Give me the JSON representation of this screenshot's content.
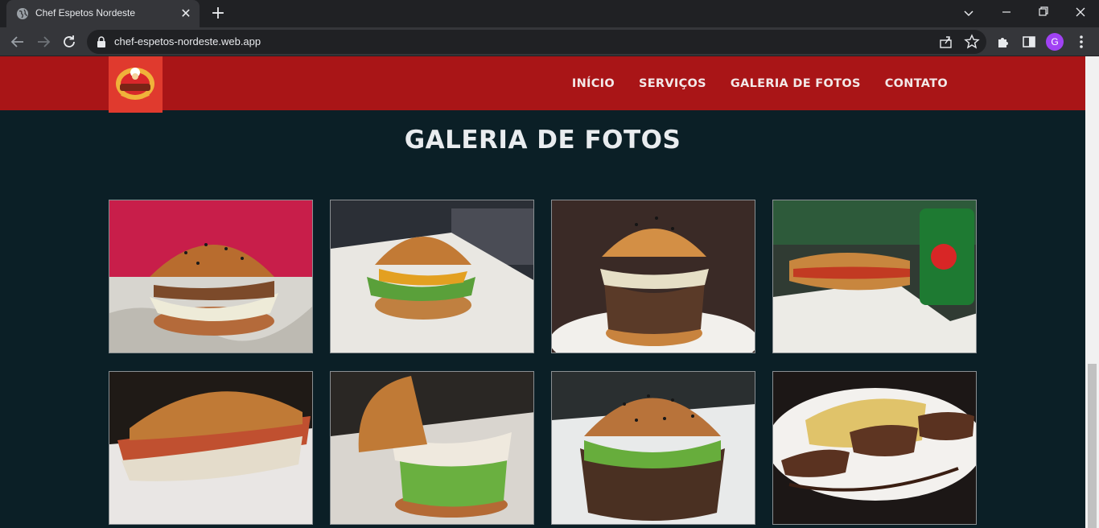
{
  "browser": {
    "tab_title": "Chef Espetos Nordeste",
    "url": "chef-espetos-nordeste.web.app",
    "profile_initial": "G",
    "icons": [
      "globe-icon",
      "close-icon",
      "plus-icon",
      "back-icon",
      "forward-icon",
      "reload-icon",
      "lock-icon",
      "share-icon",
      "star-icon",
      "extensions-icon",
      "sidepanel-icon",
      "menu-icon"
    ]
  },
  "site": {
    "nav": [
      {
        "label": "INÍCIO"
      },
      {
        "label": "SERVIÇOS"
      },
      {
        "label": "GALERIA DE FOTOS"
      },
      {
        "label": "CONTATO"
      }
    ],
    "gallery_title": "GALERIA DE FOTOS",
    "photos": [
      {
        "subject": "burger-sesame-bun"
      },
      {
        "subject": "burger-cheddar"
      },
      {
        "subject": "burger-bacon-stack"
      },
      {
        "subject": "hotdog-with-guarana-can"
      },
      {
        "subject": "long-sandwich"
      },
      {
        "subject": "burger-bacon-cheese"
      },
      {
        "subject": "burger-black-sesame"
      },
      {
        "subject": "steak-plate"
      }
    ]
  },
  "colors": {
    "header_red": "#a91517",
    "page_bg": "#0b1f26",
    "title_text": "#e9ecef"
  }
}
